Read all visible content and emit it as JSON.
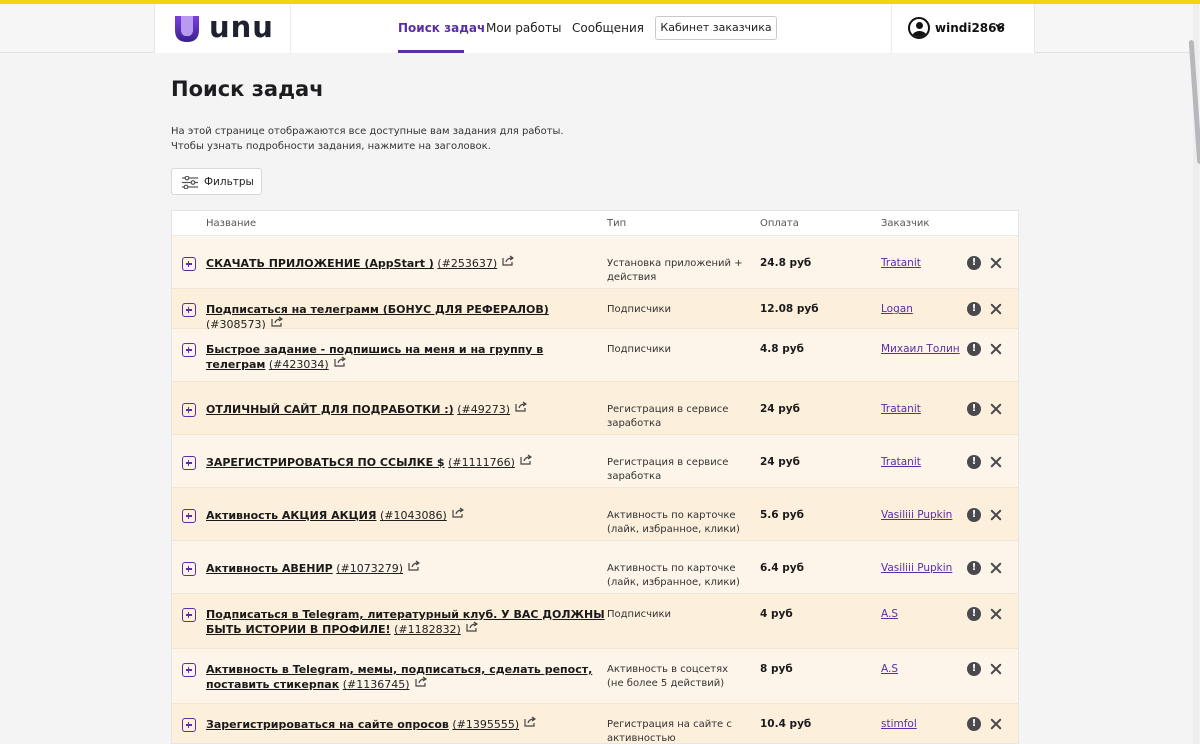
{
  "brand": {
    "name": "unu"
  },
  "nav": {
    "search_tasks": "Поиск задач",
    "my_works": "Мои работы",
    "messages": "Сообщения",
    "customer_cabinet": "Кабинет заказчика"
  },
  "user": {
    "username": "windi2866"
  },
  "page": {
    "title": "Поиск задач",
    "intro_line1": "На этой странице отображаются все доступные вам задания для работы.",
    "intro_line2": "Чтобы узнать подробности задания, нажмите на заголовок.",
    "filters_label": "Фильтры"
  },
  "table": {
    "columns": {
      "name": "Название",
      "type": "Тип",
      "payment": "Оплата",
      "customer": "Заказчик"
    },
    "rows": [
      {
        "title": "СКАЧАТЬ ПРИЛОЖЕНИЕ (AppStart )",
        "id": "(#253637)",
        "type": "Установка приложений + действия",
        "pay": "24.8 руб",
        "customer": "Tratanit"
      },
      {
        "title": "Подписаться на телеграмм (БОНУС ДЛЯ РЕФЕРАЛОВ)",
        "id": "(#308573)",
        "type": "Подписчики",
        "pay": "12.08 руб",
        "customer": "Logan"
      },
      {
        "title": "Быстрое задание - подпишись на меня и на группу в телеграм",
        "id": "(#423034)",
        "type": "Подписчики",
        "pay": "4.8 руб",
        "customer": "Михаил Толин"
      },
      {
        "title": "ОТЛИЧНЫЙ САЙТ ДЛЯ ПОДРАБОТКИ :)",
        "id": "(#49273)",
        "type": "Регистрация в сервисе заработка",
        "pay": "24 руб",
        "customer": "Tratanit"
      },
      {
        "title": "ЗАРЕГИСТРИРОВАТЬСЯ ПО ССЫЛКЕ $",
        "id": "(#1111766)",
        "type": "Регистрация в сервисе заработка",
        "pay": "24 руб",
        "customer": "Tratanit"
      },
      {
        "title": "Активность АКЦИЯ АКЦИЯ",
        "id": "(#1043086)",
        "type": "Активность по карточке (лайк, избранное, клики)",
        "pay": "5.6 руб",
        "customer": "Vasiliii Pupkin"
      },
      {
        "title": "Активность АВЕНИР",
        "id": "(#1073279)",
        "type": "Активность по карточке (лайк, избранное, клики)",
        "pay": "6.4 руб",
        "customer": "Vasiliii Pupkin"
      },
      {
        "title": "Подписаться в Telegram, литературный клуб. У ВАС ДОЛЖНЫ БЫТЬ ИСТОРИИ В ПРОФИЛЕ!",
        "id": "(#1182832)",
        "type": "Подписчики",
        "pay": "4 руб",
        "customer": "A.S"
      },
      {
        "title": "Активность в Telegram, мемы, подписаться, сделать репост, поставить стикерпак",
        "id": "(#1136745)",
        "type": "Активность в соцсетях (не более 5 действий)",
        "pay": "8 руб",
        "customer": "A.S"
      },
      {
        "title": "Зарегистрироваться на сайте опросов",
        "id": "(#1395555)",
        "type": "Регистрация на сайте с активностью",
        "pay": "10.4 руб",
        "customer": "stimfol"
      }
    ]
  }
}
